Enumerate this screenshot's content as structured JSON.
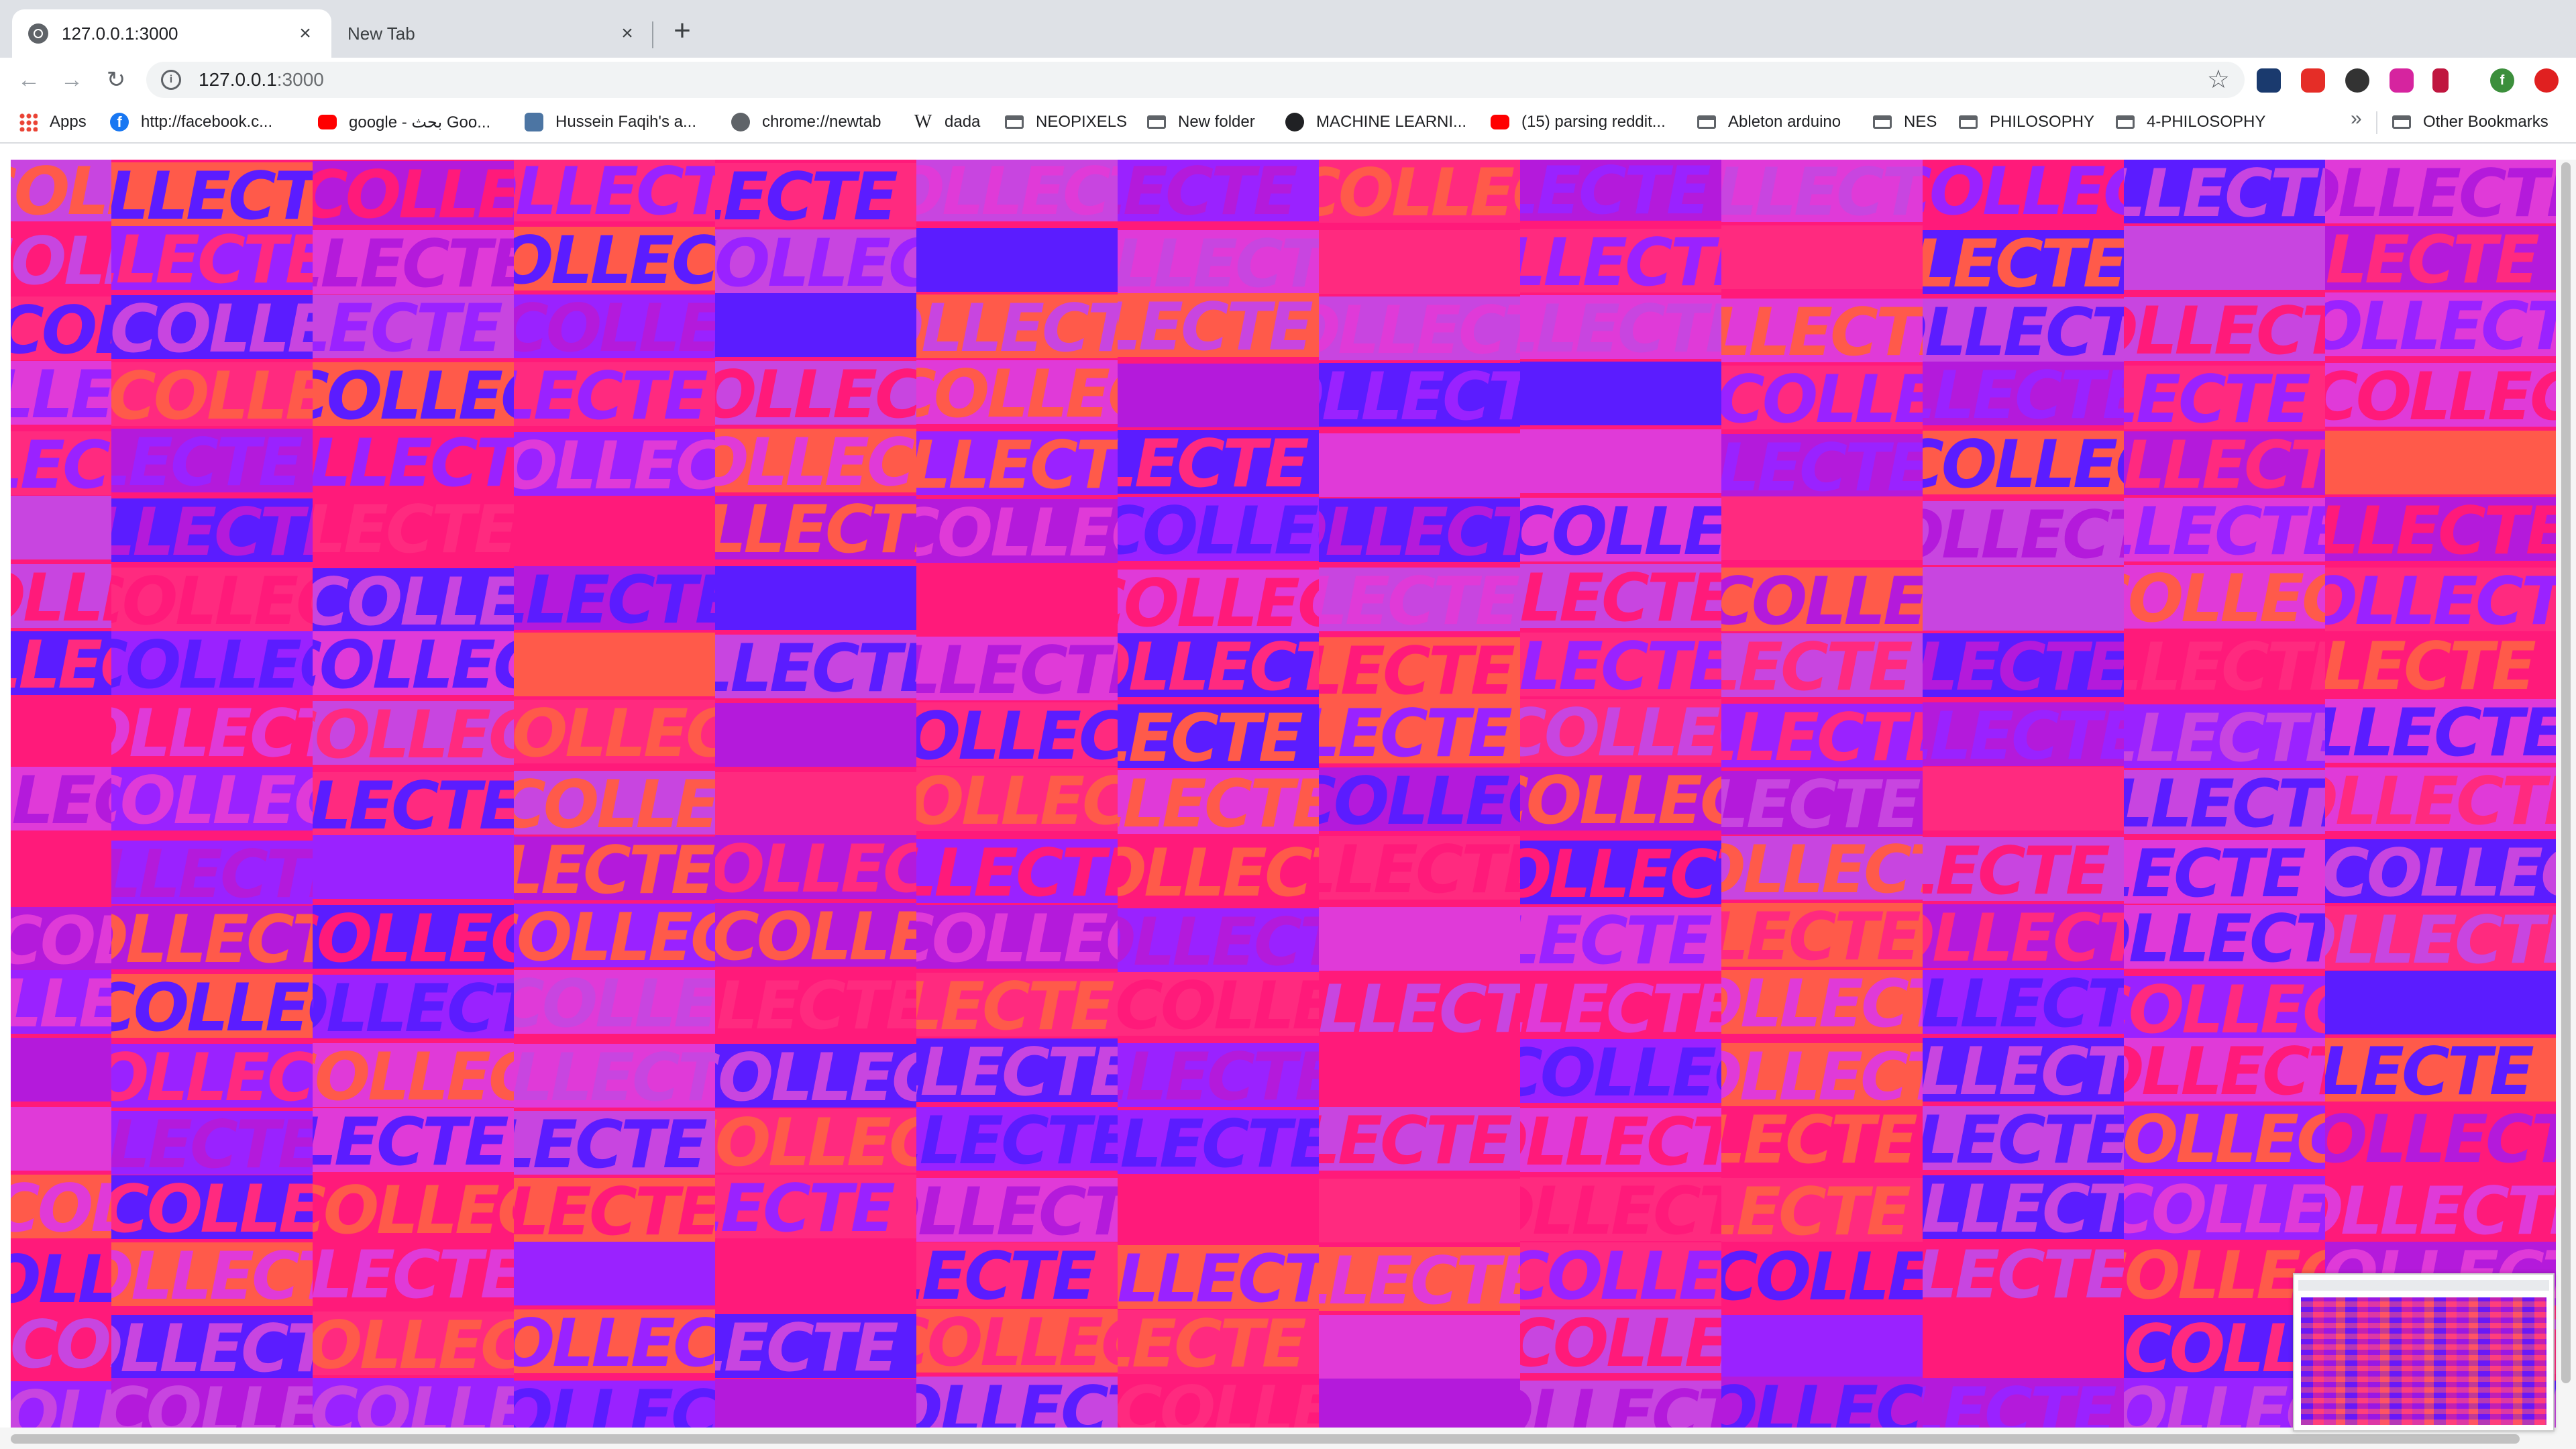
{
  "tabs": [
    {
      "title": "127.0.0.1:3000",
      "close_icon": "×",
      "active": true
    },
    {
      "title": "New Tab",
      "close_icon": "×",
      "active": false
    }
  ],
  "new_tab_icon": "+",
  "toolbar": {
    "back_icon": "←",
    "forward_icon": "→",
    "reload_icon": "↻",
    "info_icon": "i",
    "url_host": "127.0.0.1",
    "url_port": ":3000",
    "star_icon": "☆"
  },
  "extensions": [
    "chart-extension-icon",
    "youtube-extension-icon",
    "github-extension-icon",
    "instagram-extension-icon",
    "battery-extension-icon",
    "profile-avatar-icon",
    "adblock-extension-icon"
  ],
  "profile_initial": "f",
  "bookmarks": [
    {
      "label": "Apps",
      "icon": "apps-grid-icon"
    },
    {
      "label": "http://facebook.c...",
      "icon": "facebook-icon"
    },
    {
      "label": "google - بحث Goo...",
      "icon": "youtube-icon"
    },
    {
      "label": "Hussein Faqih's a...",
      "icon": "vk-icon"
    },
    {
      "label": "chrome://newtab",
      "icon": "globe-icon"
    },
    {
      "label": "dada",
      "icon": "wikipedia-icon"
    },
    {
      "label": "NEOPIXELS",
      "icon": "folder-icon"
    },
    {
      "label": "New folder",
      "icon": "folder-icon"
    },
    {
      "label": "MACHINE LEARNI...",
      "icon": "github-icon"
    },
    {
      "label": "(15) parsing reddit...",
      "icon": "youtube-icon"
    },
    {
      "label": "Ableton arduino",
      "icon": "folder-icon"
    },
    {
      "label": "NES",
      "icon": "folder-icon"
    },
    {
      "label": "PHILOSOPHY",
      "icon": "folder-icon"
    },
    {
      "label": "4-PHILOSOPHY",
      "icon": "folder-icon"
    }
  ],
  "bookmarks_more": "»",
  "other_bookmarks": "Other Bookmarks",
  "canvas": {
    "word": "COLLECTE",
    "background": "#ff1a7a",
    "palette": [
      "#5b1cff",
      "#ff2a7f",
      "#b41adb",
      "#c845e0",
      "#ff5a4a",
      "#9a22ff",
      "#ff1a7a",
      "#e03ad8"
    ]
  }
}
